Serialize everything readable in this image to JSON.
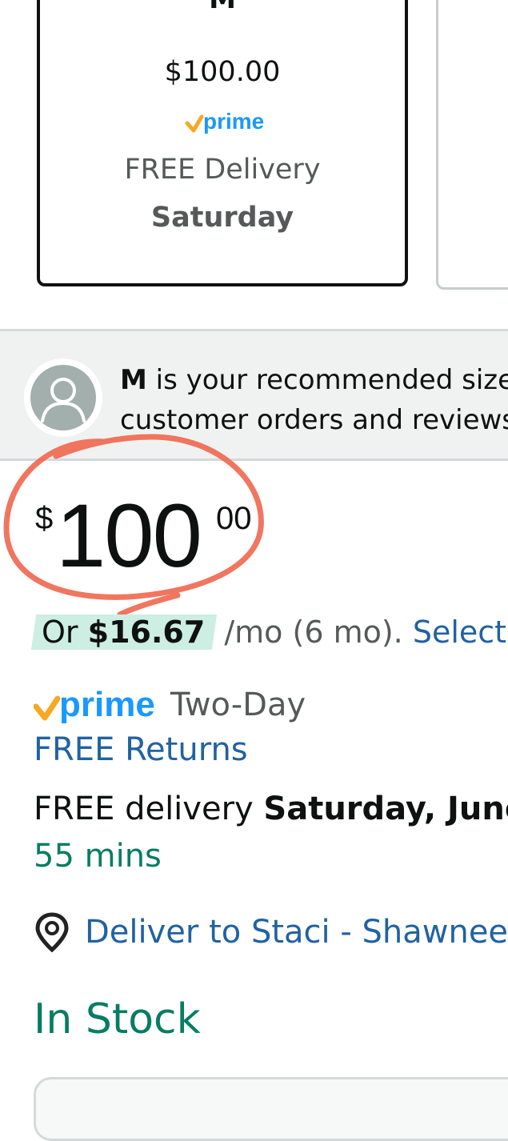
{
  "size_card": {
    "size": "M",
    "price": "$100.00",
    "prime_badge": "prime",
    "delivery": "FREE Delivery",
    "day": "Saturday"
  },
  "recommendation": {
    "size": "M",
    "line1_rest": " is your recommended size",
    "line2": "customer orders and reviews"
  },
  "price": {
    "symbol": "$",
    "whole": "100",
    "fraction": "00"
  },
  "monthly": {
    "or": "Or ",
    "amount": "$16.67",
    "term": " /mo (6 mo). ",
    "link": "Select"
  },
  "prime_row": {
    "badge": "prime",
    "label": "Two-Day"
  },
  "returns": "FREE Returns",
  "delivery": {
    "prefix": "FREE delivery ",
    "date": "Saturday, June"
  },
  "mins": "55 mins",
  "deliver_to": "Deliver to Staci - Shawnee",
  "stock": "In Stock",
  "colors": {
    "link": "#2162a1",
    "green": "#067d62",
    "prime_blue": "#1a98ff",
    "prime_check": "#f7a823",
    "annotation": "#ef6a51"
  },
  "icons": {
    "avatar": "user-avatar-icon",
    "location": "location-pin-icon"
  }
}
